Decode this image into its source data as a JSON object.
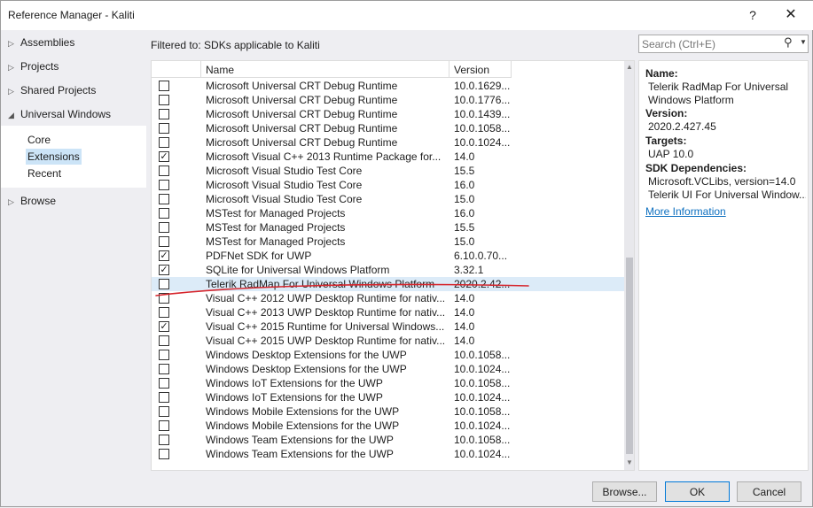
{
  "window": {
    "title": "Reference Manager - Kaliti",
    "help_label": "?",
    "close_label": "✕"
  },
  "sidebar": {
    "items": [
      {
        "label": "Assemblies",
        "expanded": false
      },
      {
        "label": "Projects",
        "expanded": false
      },
      {
        "label": "Shared Projects",
        "expanded": false
      },
      {
        "label": "Universal Windows",
        "expanded": true
      },
      {
        "label": "Browse",
        "expanded": false
      }
    ],
    "subitems": [
      {
        "label": "Core",
        "selected": false
      },
      {
        "label": "Extensions",
        "selected": true
      },
      {
        "label": "Recent",
        "selected": false
      }
    ]
  },
  "filter_text": "Filtered to: SDKs applicable to Kaliti",
  "search": {
    "placeholder": "Search (Ctrl+E)",
    "icon": "search-icon"
  },
  "table": {
    "columns": [
      "Name",
      "Version"
    ],
    "rows": [
      {
        "checked": false,
        "name": "Microsoft Universal CRT Debug Runtime",
        "version": "10.0.1629..."
      },
      {
        "checked": false,
        "name": "Microsoft Universal CRT Debug Runtime",
        "version": "10.0.1776..."
      },
      {
        "checked": false,
        "name": "Microsoft Universal CRT Debug Runtime",
        "version": "10.0.1439..."
      },
      {
        "checked": false,
        "name": "Microsoft Universal CRT Debug Runtime",
        "version": "10.0.1058..."
      },
      {
        "checked": false,
        "name": "Microsoft Universal CRT Debug Runtime",
        "version": "10.0.1024..."
      },
      {
        "checked": true,
        "name": "Microsoft Visual C++ 2013 Runtime Package for...",
        "version": "14.0"
      },
      {
        "checked": false,
        "name": "Microsoft Visual Studio Test Core",
        "version": "15.5"
      },
      {
        "checked": false,
        "name": "Microsoft Visual Studio Test Core",
        "version": "16.0"
      },
      {
        "checked": false,
        "name": "Microsoft Visual Studio Test Core",
        "version": "15.0"
      },
      {
        "checked": false,
        "name": "MSTest for Managed Projects",
        "version": "16.0"
      },
      {
        "checked": false,
        "name": "MSTest for Managed Projects",
        "version": "15.5"
      },
      {
        "checked": false,
        "name": "MSTest for Managed Projects",
        "version": "15.0"
      },
      {
        "checked": true,
        "name": "PDFNet SDK for UWP",
        "version": "6.10.0.70..."
      },
      {
        "checked": true,
        "name": "SQLite for Universal Windows Platform",
        "version": "3.32.1"
      },
      {
        "checked": false,
        "name": "Telerik RadMap For Universal Windows Platform",
        "version": "2020.2.42...",
        "highlighted": true
      },
      {
        "checked": false,
        "name": "Visual C++ 2012 UWP Desktop Runtime for nativ...",
        "version": "14.0"
      },
      {
        "checked": false,
        "name": "Visual C++ 2013 UWP Desktop Runtime for nativ...",
        "version": "14.0"
      },
      {
        "checked": true,
        "name": "Visual C++ 2015 Runtime for Universal Windows...",
        "version": "14.0"
      },
      {
        "checked": false,
        "name": "Visual C++ 2015 UWP Desktop Runtime for nativ...",
        "version": "14.0"
      },
      {
        "checked": false,
        "name": "Windows Desktop Extensions for the UWP",
        "version": "10.0.1058..."
      },
      {
        "checked": false,
        "name": "Windows Desktop Extensions for the UWP",
        "version": "10.0.1024..."
      },
      {
        "checked": false,
        "name": "Windows IoT Extensions for the UWP",
        "version": "10.0.1058..."
      },
      {
        "checked": false,
        "name": "Windows IoT Extensions for the UWP",
        "version": "10.0.1024..."
      },
      {
        "checked": false,
        "name": "Windows Mobile Extensions for the UWP",
        "version": "10.0.1058..."
      },
      {
        "checked": false,
        "name": "Windows Mobile Extensions for the UWP",
        "version": "10.0.1024..."
      },
      {
        "checked": false,
        "name": "Windows Team Extensions for the UWP",
        "version": "10.0.1058..."
      },
      {
        "checked": false,
        "name": "Windows Team Extensions for the UWP",
        "version": "10.0.1024..."
      }
    ]
  },
  "details": {
    "name_label": "Name:",
    "name_value_1": "Telerik RadMap For Universal",
    "name_value_2": "Windows Platform",
    "version_label": "Version:",
    "version_value": "2020.2.427.45",
    "targets_label": "Targets:",
    "targets_value": "UAP 10.0",
    "deps_label": "SDK Dependencies:",
    "deps_value_1": "Microsoft.VCLibs, version=14.0",
    "deps_value_2": "Telerik UI For Universal Window...",
    "more_info": "More Information"
  },
  "buttons": {
    "browse": "Browse...",
    "ok": "OK",
    "cancel": "Cancel"
  },
  "colors": {
    "annotation": "#d6262d",
    "selection": "#cce4f7",
    "row_highlight": "#dcebf8",
    "link": "#0e70c0"
  }
}
